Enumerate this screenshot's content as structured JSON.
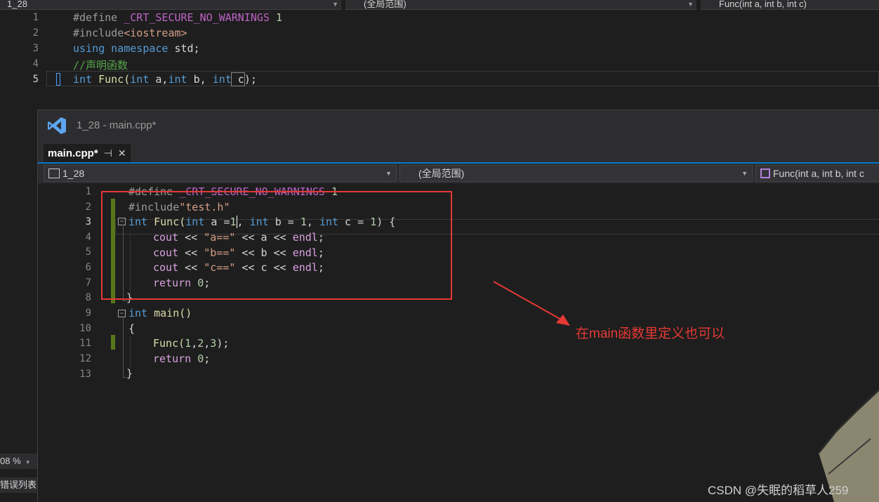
{
  "background_editor": {
    "nav": {
      "project": "1_28",
      "scope": "(全局范围)",
      "member": "Func(int a, int b, int c)"
    },
    "line_numbers": [
      "1",
      "2",
      "3",
      "4",
      "5"
    ],
    "lines": [
      {
        "a": "#define ",
        "b": "_CRT_SECURE_NO_WARNINGS",
        "c": " 1"
      },
      {
        "a": "#include",
        "b": "<iostream>"
      },
      {
        "a": "using",
        "b": " namespace ",
        "c": "std;"
      },
      {
        "a": "//声明函数"
      },
      {
        "a": "int",
        "b": " Func(",
        "c": "int",
        "d": " a,",
        "e": "int",
        "f": " b, ",
        "g": "int",
        "h": " c",
        "i": ");"
      }
    ],
    "zoom": "08 %",
    "error_list": "错误列表"
  },
  "window": {
    "title": "1_28 - main.cpp*",
    "tab": {
      "label": "main.cpp*",
      "pin": "⊣",
      "close": "✕"
    },
    "nav": {
      "project": "1_28",
      "scope": "(全局范围)",
      "member": "Func(int a, int b, int c"
    },
    "line_numbers": [
      "1",
      "2",
      "3",
      "4",
      "5",
      "6",
      "7",
      "8",
      "9",
      "10",
      "11",
      "12",
      "13"
    ],
    "code": {
      "l1": {
        "a": "#define ",
        "b": "_CRT_SECURE_NO_WARNINGS",
        "c": " 1"
      },
      "l2": {
        "a": "#include",
        "b": "\"test.h\""
      },
      "l3": {
        "a": "int",
        "b": " Func(",
        "c": "int",
        "d": " a =",
        "e": "1",
        "f": ", ",
        "g": "int",
        "h": " b = ",
        "i": "1",
        "j": ", ",
        "k": "int",
        "l": " c = ",
        "m": "1",
        "n": ") {"
      },
      "l4": {
        "a": "cout",
        "b": " << ",
        "c": "\"a==\"",
        "d": " << a << ",
        "e": "endl",
        "f": ";"
      },
      "l5": {
        "a": "cout",
        "b": " << ",
        "c": "\"b==\"",
        "d": " << b << ",
        "e": "endl",
        "f": ";"
      },
      "l6": {
        "a": "cout",
        "b": " << ",
        "c": "\"c==\"",
        "d": " << c << ",
        "e": "endl",
        "f": ";"
      },
      "l7": {
        "a": "return",
        "b": " ",
        "c": "0",
        "d": ";"
      },
      "l8": {
        "a": "}"
      },
      "l9": {
        "a": "int",
        "b": " main()"
      },
      "l10": {
        "a": "{"
      },
      "l11": {
        "a": "Func(",
        "b": "1",
        "c": ",",
        "d": "2",
        "e": ",",
        "f": "3",
        "g": ");"
      },
      "l12": {
        "a": "return",
        "b": " ",
        "c": "0",
        "d": ";"
      },
      "l13": {
        "a": "}"
      }
    }
  },
  "annotation": "在main函数里定义也可以",
  "watermark": "CSDN @失眠的稻草人259",
  "colors": {
    "accent": "#007acc",
    "annotation": "#e53935",
    "change_bar": "#57761c"
  }
}
